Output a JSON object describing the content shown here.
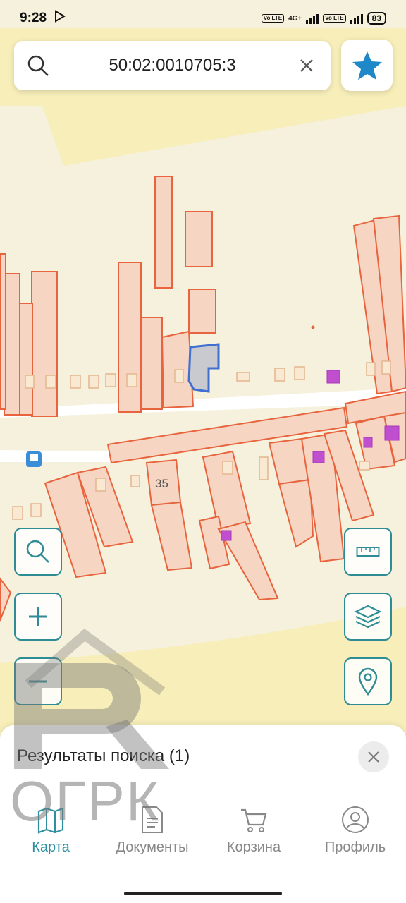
{
  "status": {
    "time": "9:28",
    "network": "4G+",
    "battery": "83",
    "lte1": "Vo LTE",
    "lte2": "Vo LTE"
  },
  "search": {
    "value": "50:02:0010705:3",
    "placeholder": ""
  },
  "map": {
    "house_number": "35"
  },
  "results": {
    "title": "Результаты поиска (1)"
  },
  "nav": {
    "items": [
      {
        "label": "Карта",
        "icon": "map-icon",
        "active": true
      },
      {
        "label": "Документы",
        "icon": "document-icon",
        "active": false
      },
      {
        "label": "Корзина",
        "icon": "cart-icon",
        "active": false
      },
      {
        "label": "Профиль",
        "icon": "profile-icon",
        "active": false
      }
    ]
  },
  "watermark": {
    "text": "ОГРК"
  },
  "colors": {
    "accent": "#2e8fa0",
    "parcel_stroke": "#e8643f",
    "parcel_fill": "#f6d6c2",
    "selected": "#3f6fd1",
    "building": "#c04fd0"
  }
}
